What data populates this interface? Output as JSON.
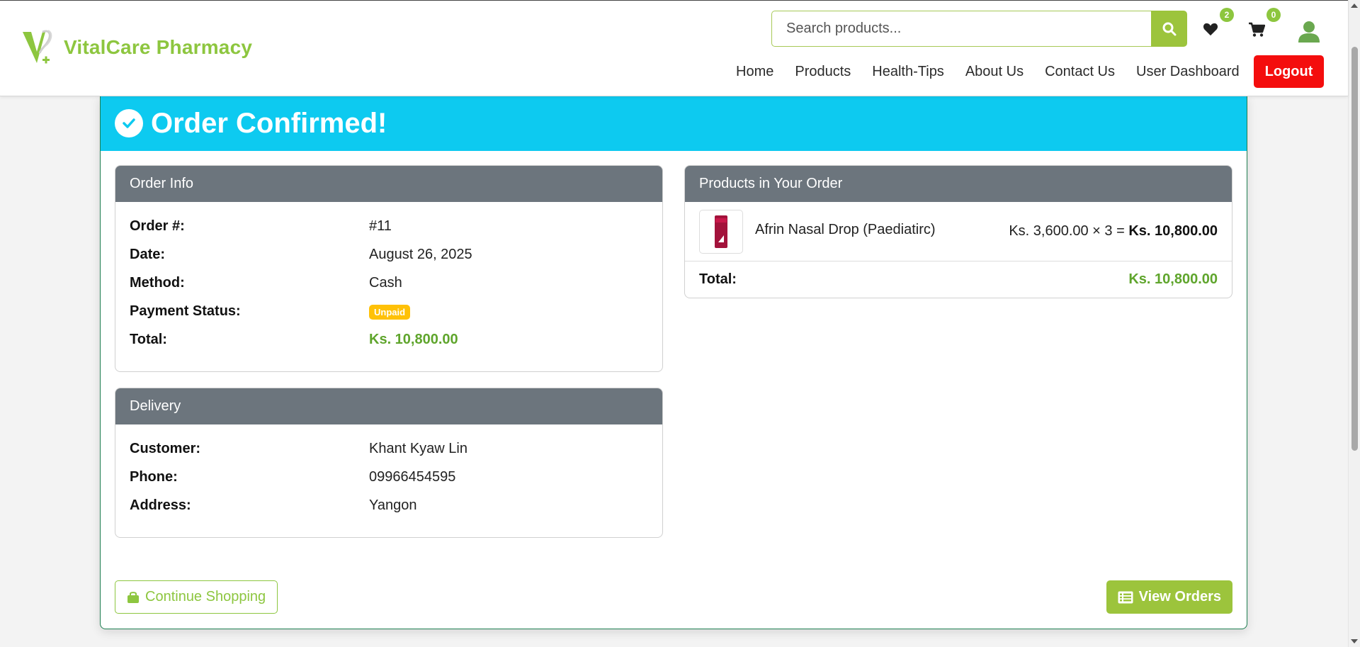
{
  "brand": {
    "name": "VitalCare Pharmacy",
    "accent": "#8dc63f"
  },
  "search": {
    "placeholder": "Search products..."
  },
  "header": {
    "wishlist_count": "2",
    "cart_count": "0"
  },
  "nav": {
    "items": [
      "Home",
      "Products",
      "Health-Tips",
      "About Us",
      "Contact Us",
      "User Dashboard"
    ],
    "logout": "Logout"
  },
  "confirmation": {
    "title": "Order Confirmed!",
    "header_color": "#0dcaf0"
  },
  "order_info": {
    "title": "Order Info",
    "order_label": "Order #:",
    "order_value": "#11",
    "date_label": "Date:",
    "date_value": "August 26, 2025",
    "method_label": "Method:",
    "method_value": "Cash",
    "status_label": "Payment Status:",
    "status_value": "Unpaid",
    "total_label": "Total:",
    "total_value": "Ks. 10,800.00"
  },
  "delivery": {
    "title": "Delivery",
    "customer_label": "Customer:",
    "customer_value": "Khant Kyaw Lin",
    "phone_label": "Phone:",
    "phone_value": "09966454595",
    "address_label": "Address:",
    "address_value": "Yangon"
  },
  "products": {
    "title": "Products in Your Order",
    "items": [
      {
        "name": "Afrin Nasal Drop (Paediatirc)",
        "unit_price": "Ks. 3,600.00 × 3 =",
        "line_total": "Ks. 10,800.00"
      }
    ],
    "total_label": "Total:",
    "total_value": "Ks. 10,800.00"
  },
  "actions": {
    "continue": "Continue Shopping",
    "view_orders": "View Orders"
  }
}
